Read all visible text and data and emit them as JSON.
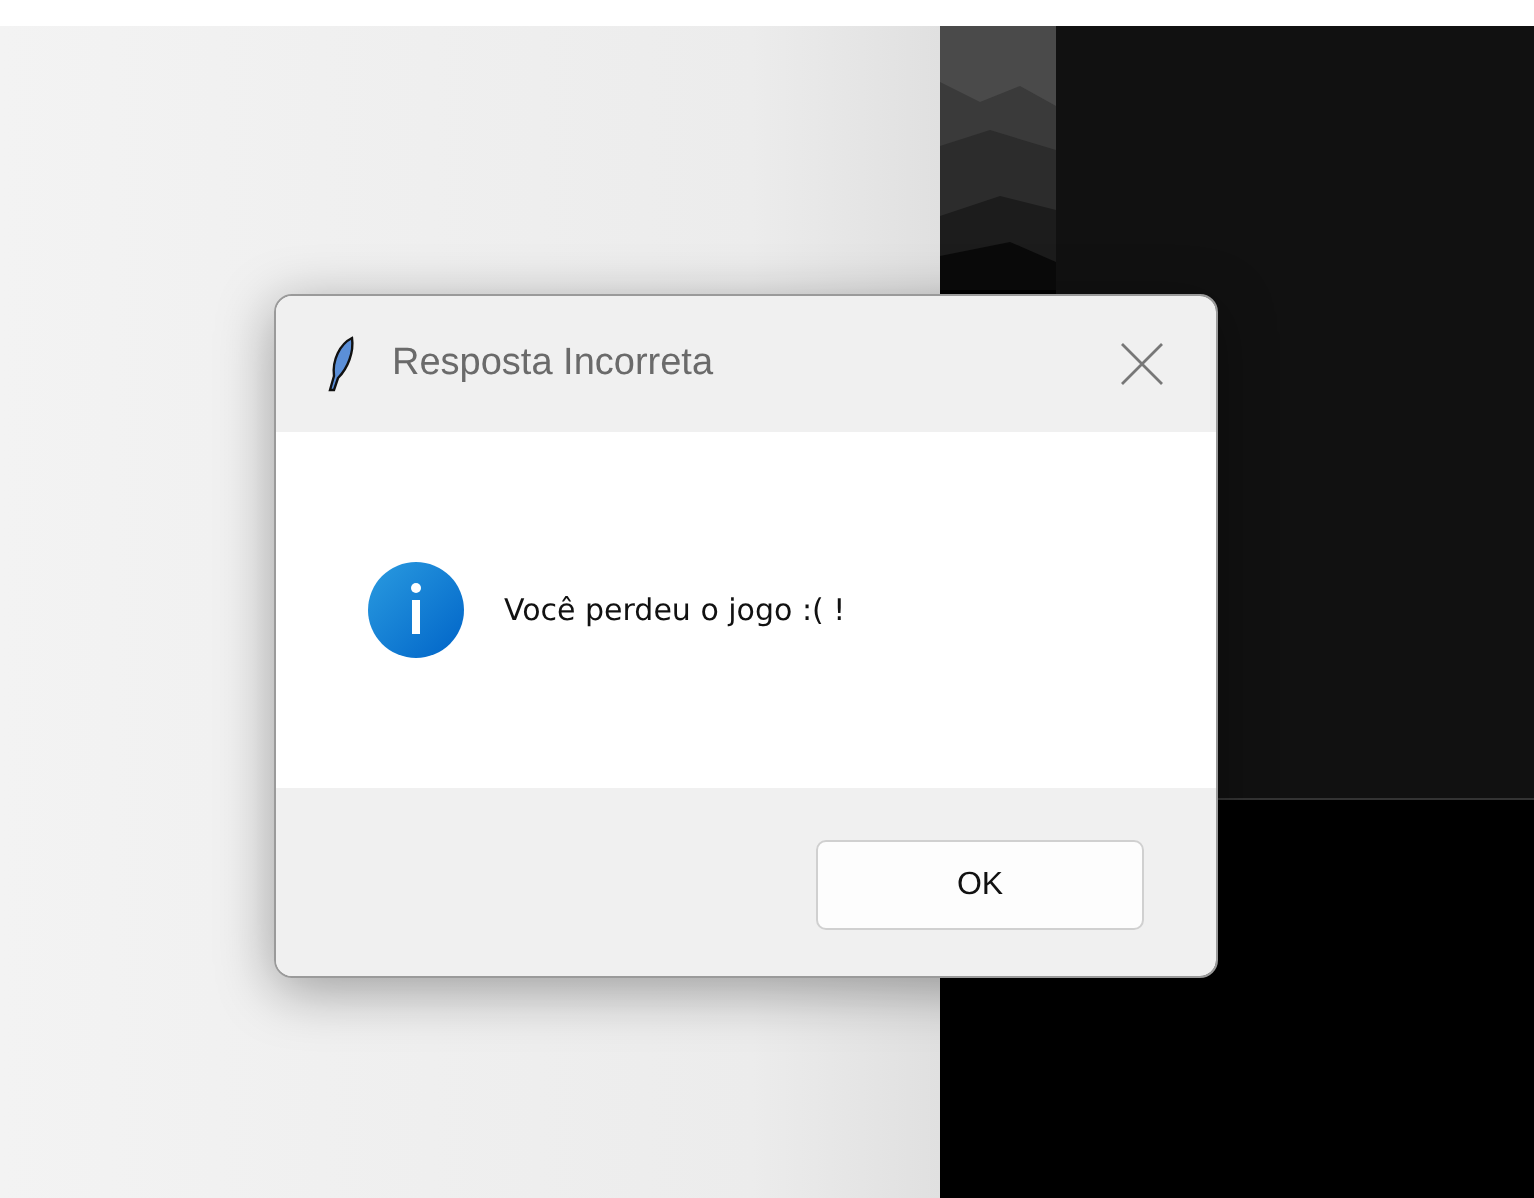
{
  "dialog": {
    "title": "Resposta Incorreta",
    "message": "Você perdeu o jogo :( !",
    "buttons": [
      "OK"
    ]
  }
}
